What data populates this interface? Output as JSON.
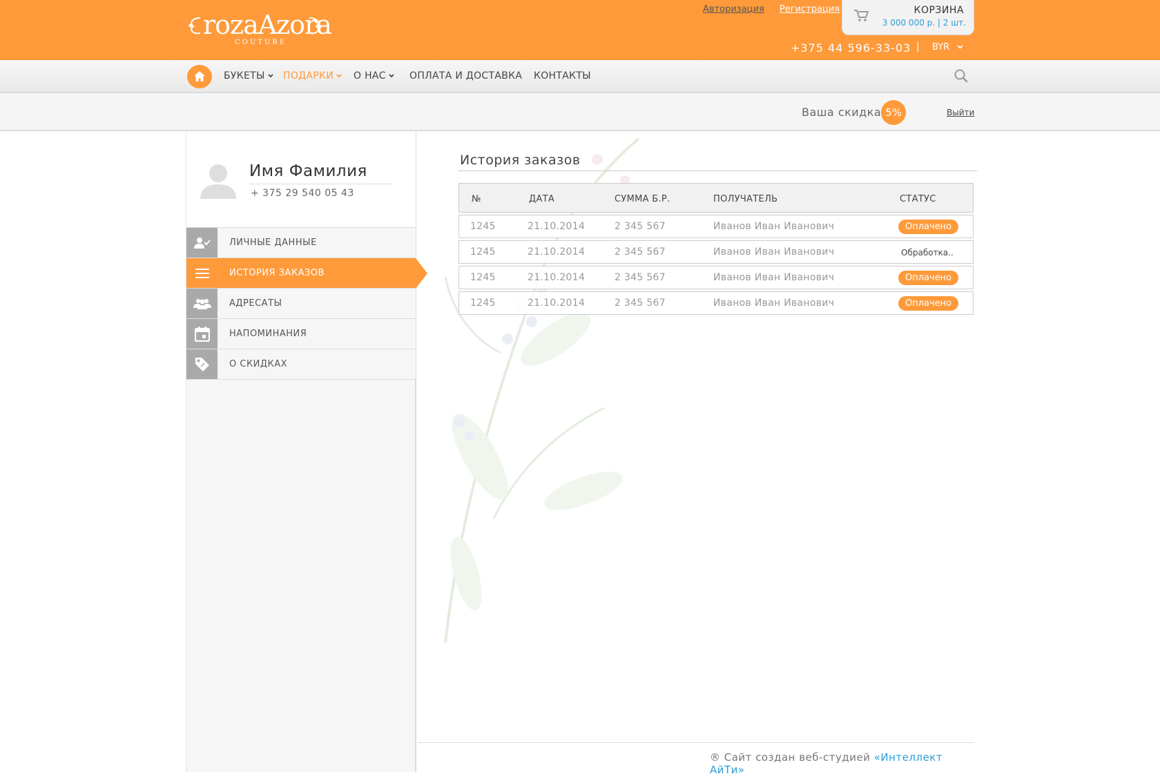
{
  "header": {
    "logo_text": "rozaAzora",
    "logo_sub": "COUTURE",
    "links": {
      "login": "Авторизация",
      "register": "Регистрация"
    },
    "cart": {
      "title": "КОРЗИНА",
      "summary": "3 000 000 р.  |  2 шт."
    },
    "phone": "+375 44 596-33-03",
    "separator": "|",
    "currency": "BYR"
  },
  "nav": {
    "items": [
      {
        "label": "БУКЕТЫ"
      },
      {
        "label": "ПОДАРКИ"
      },
      {
        "label": "О НАС"
      },
      {
        "label": "ОПЛАТА И ДОСТАВКА"
      },
      {
        "label": "КОНТАКТЫ"
      }
    ]
  },
  "subbar": {
    "discount_label": "Ваша скидка:",
    "discount_value": "5%",
    "logout": "Выйти"
  },
  "profile": {
    "name": "Имя Фамилия",
    "phone": "+ 375 29 540 05 43"
  },
  "sidebar": {
    "items": [
      {
        "label": "ЛИЧНЫЕ ДАННЫЕ",
        "icon": "user-check-icon"
      },
      {
        "label": "ИСТОРИЯ ЗАКАЗОВ",
        "icon": "list-icon"
      },
      {
        "label": "АДРЕСАТЫ",
        "icon": "group-icon"
      },
      {
        "label": "НАПОМИНАНИЯ",
        "icon": "calendar-icon"
      },
      {
        "label": "О СКИДКАХ",
        "icon": "tag-icon"
      }
    ]
  },
  "orders": {
    "title": "История заказов",
    "columns": [
      "№",
      "ДАТА",
      "СУММА Б.Р.",
      "ПОЛУЧАТЕЛЬ",
      "СТАТУС"
    ],
    "rows": [
      {
        "num": "1245",
        "date": "21.10.2014",
        "sum": "2 345 567",
        "recipient": "Иванов Иван Иванович",
        "status": "Оплачено"
      },
      {
        "num": "1245",
        "date": "21.10.2014",
        "sum": "2 345 567",
        "recipient": "Иванов Иван Иванович",
        "status": "Обработка.."
      },
      {
        "num": "1245",
        "date": "21.10.2014",
        "sum": "2 345 567",
        "recipient": "Иванов Иван Иванович",
        "status": "Оплачено"
      },
      {
        "num": "1245",
        "date": "21.10.2014",
        "sum": "2 345 567",
        "recipient": "Иванов Иван Иванович",
        "status": "Оплачено"
      }
    ]
  },
  "footer": {
    "text": "® Сайт создан веб-студией ",
    "studio": "«Интеллект АйТи»"
  },
  "colors": {
    "accent": "#fe9a3a",
    "link_blue": "#2d9cd8",
    "icon_gray": "#a9a9a9"
  }
}
